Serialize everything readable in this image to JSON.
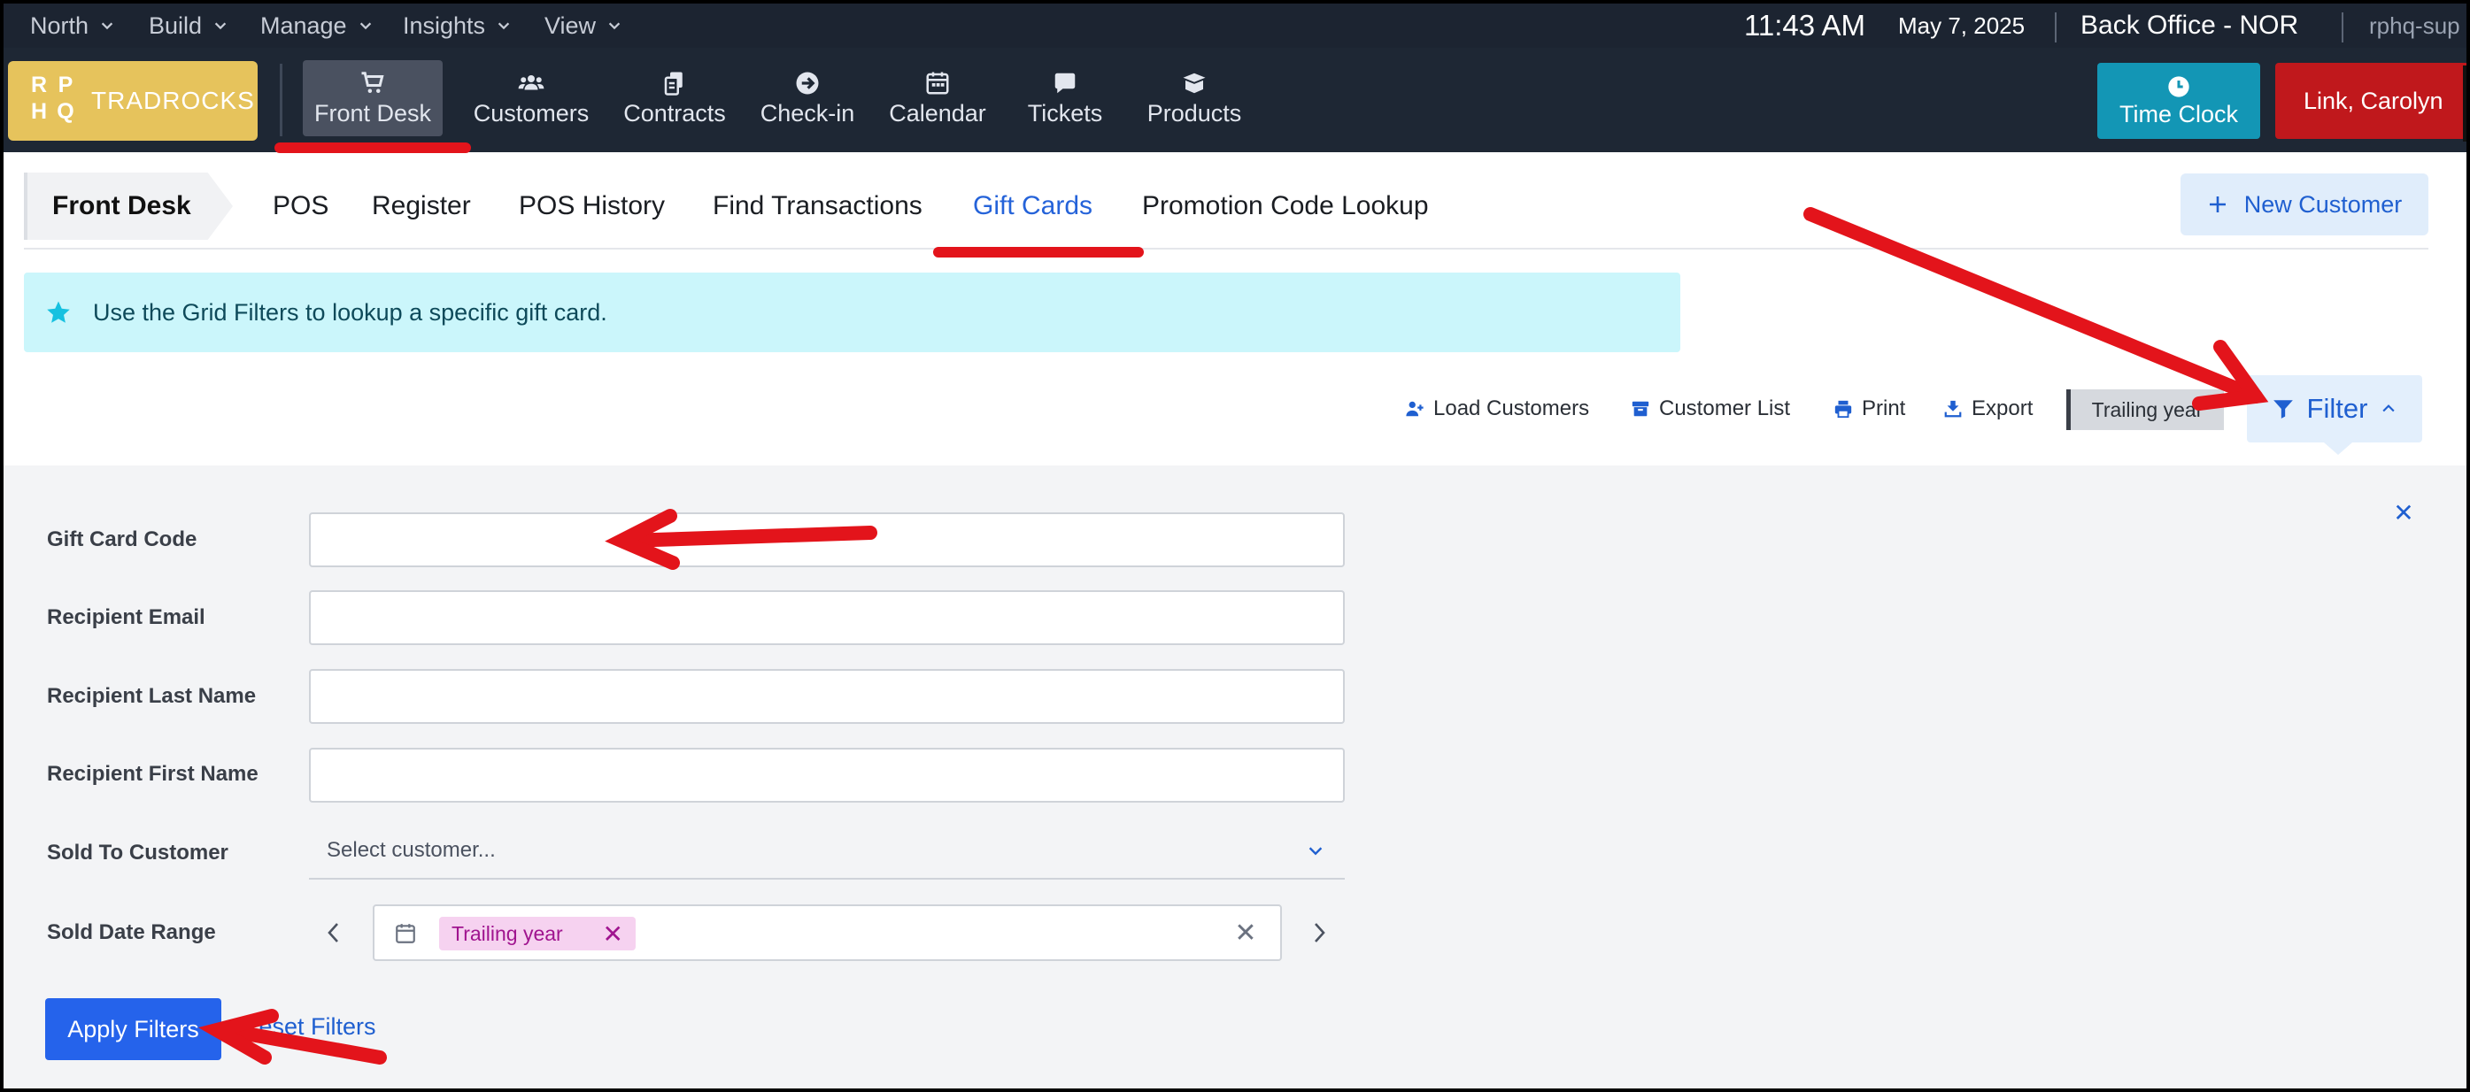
{
  "topbar": {
    "menus": [
      "North",
      "Build",
      "Manage",
      "Insights",
      "View"
    ],
    "time": "11:43 AM",
    "date": "May 7, 2025",
    "location": "Back Office - NOR",
    "user_id": "rphq-sup"
  },
  "navbar": {
    "logo_mark": [
      "R",
      "P",
      "H",
      "Q"
    ],
    "logo_text": "TRADROCKS",
    "items": [
      {
        "label": "Front Desk",
        "icon": "cart-icon"
      },
      {
        "label": "Customers",
        "icon": "users-icon"
      },
      {
        "label": "Contracts",
        "icon": "contracts-icon"
      },
      {
        "label": "Check-in",
        "icon": "arrow-circle-icon"
      },
      {
        "label": "Calendar",
        "icon": "calendar-icon"
      },
      {
        "label": "Tickets",
        "icon": "chat-icon"
      },
      {
        "label": "Products",
        "icon": "box-icon"
      }
    ],
    "time_clock": "Time Clock",
    "user_name": "Link, Carolyn"
  },
  "subnav": {
    "section": "Front Desk",
    "tabs": [
      "POS",
      "Register",
      "POS History",
      "Find Transactions",
      "Gift Cards",
      "Promotion Code Lookup"
    ],
    "active_tab": "Gift Cards",
    "new_customer": "New Customer"
  },
  "banner": {
    "text": "Use the Grid Filters to lookup a specific gift card."
  },
  "toolbar": {
    "load_customers": "Load Customers",
    "customer_list": "Customer List",
    "print": "Print",
    "export": "Export",
    "date_chip": "Trailing year",
    "filter": "Filter"
  },
  "filters": {
    "gift_card_code": {
      "label": "Gift Card Code",
      "value": ""
    },
    "recipient_email": {
      "label": "Recipient Email",
      "value": ""
    },
    "recipient_last_name": {
      "label": "Recipient Last Name",
      "value": ""
    },
    "recipient_first_name": {
      "label": "Recipient First Name",
      "value": ""
    },
    "sold_to_customer": {
      "label": "Sold To Customer",
      "placeholder": "Select customer..."
    },
    "sold_date_range": {
      "label": "Sold Date Range",
      "value": "Trailing year"
    },
    "apply": "Apply Filters",
    "reset": "Reset Filters"
  },
  "colors": {
    "nav_bg": "#1e2734",
    "accent": "#2563eb",
    "time_clock": "#1396b5",
    "user_button": "#c0181c",
    "annotation": "#e3141b",
    "banner": "#cbf6fb"
  }
}
